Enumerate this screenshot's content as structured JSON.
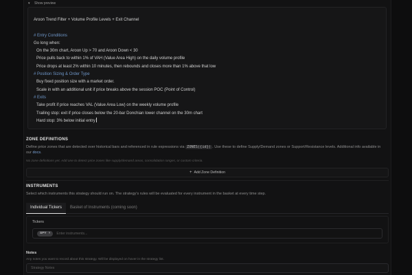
{
  "preview": {
    "toggle_label": "Show preview"
  },
  "editor": {
    "title": "Aroon Trend Filter + Volume Profile Levels + Exit Channel",
    "entry_heading": "# Entry Conditions",
    "go_long": "Go long when:",
    "entry_items": [
      "On the 30m chart, Aroon Up > 70 and Aroon Down < 30",
      "Price pulls back to within 1% of VAH (Value Area High) on the daily volume profile",
      "Price drops at least 2% within 10 minutes, then rebounds and closes more than 1% above that low"
    ],
    "sizing_heading": "# Position Sizing & Order Type",
    "sizing_items": [
      "Buy fixed position size with a market order.",
      "Scale in with an additional unit if price breaks above the session POC (Point of Control)"
    ],
    "exits_heading": "# Exits",
    "exit_items": [
      "Take profit if price reaches VAL (Value Area Low) on the weekly volume profile",
      "Trailing stop: exit if price closes below the 20-bar Donchian lower channel on the 30m chart",
      "Hard stop: 3% below initial entry"
    ]
  },
  "zones": {
    "title": "ZONE DEFINITIONS",
    "desc_before": "Define price zones that are detected over historical bars and referenced in rule expressions via",
    "code": "ZONES({id})",
    "desc_after": ". Use these to define Supply/Demand zones or Support/Resistance levels. Additional info available in our",
    "link": "docs",
    "link_after": ".",
    "empty_note": "No zone definitions yet. Add one to detect price zones like supply/demand areas, consolidation ranges, or custom criteria.",
    "add_button": "Add Zone Definition"
  },
  "instruments": {
    "title": "INSTRUMENTS",
    "desc": "Select which instruments this strategy should run on. The strategy's rules will be evaluated for every instrument in the basket at every time step.",
    "tabs": [
      "Individual Tickers",
      "Basket of Instruments (coming soon)"
    ],
    "tickers_label": "Tickers",
    "chip": "SPY",
    "placeholder": "Enter instruments..."
  },
  "notes": {
    "label": "Notes",
    "desc": "Any notes you want to record about this strategy. Will be displayed on hover in the strategy list.",
    "placeholder": "Strategy Notes"
  }
}
